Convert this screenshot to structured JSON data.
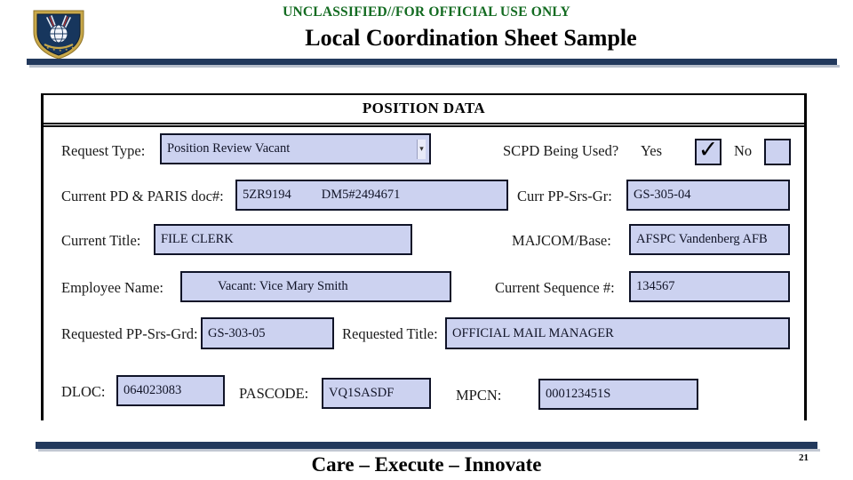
{
  "header": {
    "classification": "UNCLASSIFIED//FOR OFFICIAL USE ONLY",
    "title": "Local Coordination Sheet Sample",
    "classification_color": "#136b21",
    "bar_color": "#22395c",
    "emblem_name": "air-force-shield-emblem"
  },
  "form": {
    "section_title": "POSITION DATA",
    "field_fill_color": "#ccd2f0",
    "field_border_color": "#101428",
    "rows": [
      {
        "label": "Request Type:",
        "value": "Position Review Vacant",
        "control": "dropdown",
        "caret": "▾"
      },
      {
        "label": "SCPD Being Used?",
        "yes_label": "Yes",
        "no_label": "No",
        "yes_checked": true,
        "no_checked": false,
        "check_glyph": "✓"
      },
      {
        "label": "Current PD & PARIS doc#:",
        "value": "5ZR9194",
        "value2": "DM5#2494671"
      },
      {
        "label": "Curr PP-Srs-Gr:",
        "value": "GS-305-04"
      },
      {
        "label": "Current Title:",
        "value": "FILE CLERK"
      },
      {
        "label": "MAJCOM/Base:",
        "value": "AFSPC Vandenberg AFB"
      },
      {
        "label": "Employee Name:",
        "value": "Vacant: Vice Mary Smith"
      },
      {
        "label": "Current Sequence #:",
        "value": "134567"
      },
      {
        "label": "Requested PP-Srs-Grd:",
        "value": "GS-303-05"
      },
      {
        "label": "Requested Title:",
        "value": "OFFICIAL MAIL MANAGER"
      },
      {
        "label": "DLOC:",
        "value": "064023083"
      },
      {
        "label": "PASCODE:",
        "value": "VQ1SASDF"
      },
      {
        "label": "MPCN:",
        "value": "000123451S"
      }
    ]
  },
  "footer": {
    "motto": "Care – Execute – Innovate",
    "page_number": "21",
    "bar_color": "#22395c"
  }
}
